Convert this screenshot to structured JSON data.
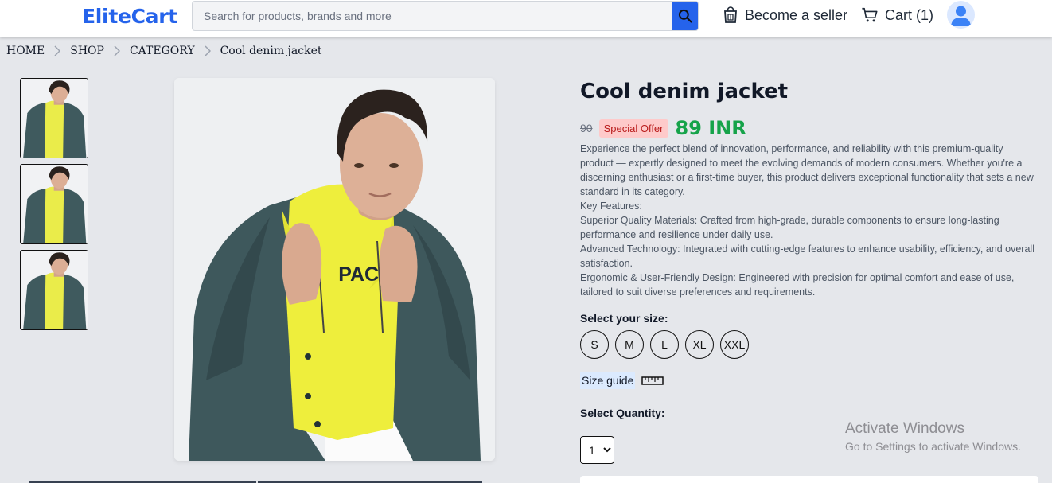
{
  "header": {
    "logo": "EliteCart",
    "search_placeholder": "Search for products, brands and more",
    "seller_label": "Become a seller",
    "cart_label": "Cart (1)"
  },
  "breadcrumb": [
    "HOME",
    "SHOP",
    "CATEGORY",
    "Cool denim jacket"
  ],
  "product": {
    "title": "Cool denim jacket",
    "old_price": "90",
    "offer_badge": "Special Offer",
    "price": "89 INR",
    "description": [
      "Experience the perfect blend of innovation, performance, and reliability with this premium-quality product — expertly designed to meet the evolving demands of modern consumers. Whether you're a discerning enthusiast or a first-time buyer, this product delivers exceptional functionality that sets a new standard in its category.",
      "Key Features:",
      "Superior Quality Materials: Crafted from high-grade, durable components to ensure long-lasting performance and resilience under daily use.",
      "Advanced Technology: Integrated with cutting-edge features to enhance usability, efficiency, and overall satisfaction.",
      "Ergonomic & User-Friendly Design: Engineered with precision for optimal comfort and ease of use, tailored to suit diverse preferences and requirements."
    ],
    "size_label": "Select your size:",
    "sizes": [
      "S",
      "M",
      "L",
      "XL",
      "XXL"
    ],
    "size_guide": "Size guide",
    "quantity_label": "Select Quantity:",
    "quantity": "1"
  },
  "image": {
    "shirt_print": "PACE"
  },
  "watermark": {
    "title": "Activate Windows",
    "subtitle": "Go to Settings to activate Windows."
  },
  "colors": {
    "accent": "#2563eb",
    "price_green": "#16a34a",
    "offer_bg": "#fecaca",
    "offer_text": "#b91c1c",
    "background": "#e5e7eb"
  },
  "icons": {
    "search": "search-icon",
    "seller": "store-icon",
    "cart": "cart-icon",
    "avatar": "user-icon",
    "breadcrumb_separator": "chevron-right-icon",
    "size_guide": "ruler-icon"
  }
}
